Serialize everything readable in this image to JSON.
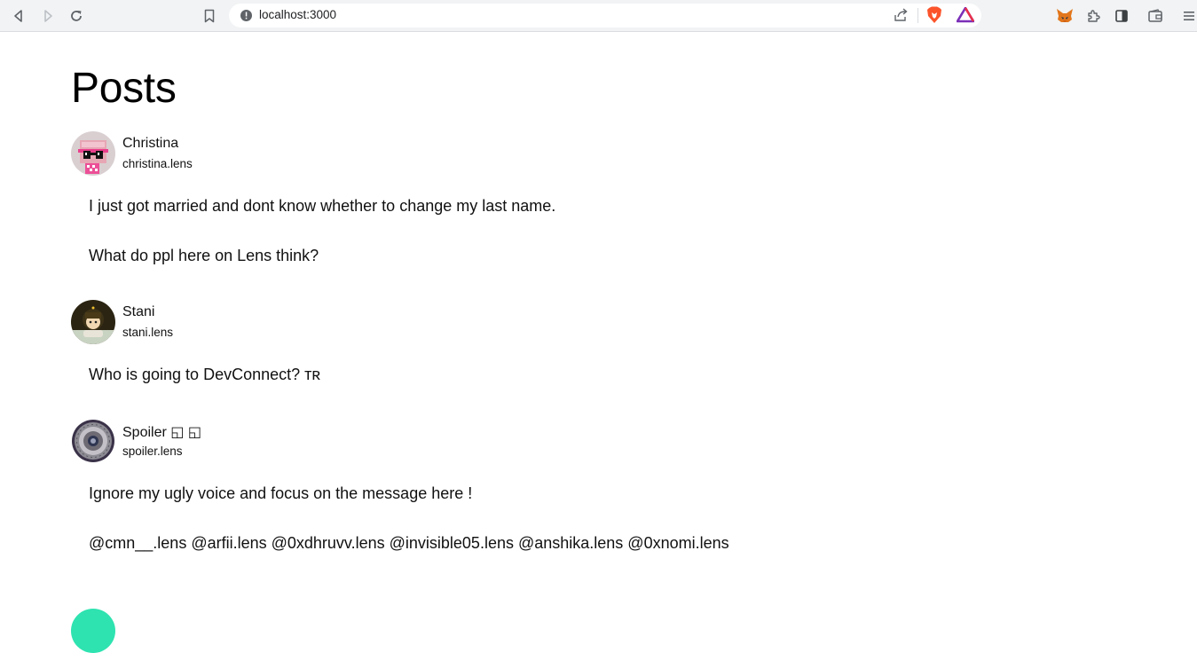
{
  "browser": {
    "url": "localhost:3000",
    "icons": [
      "back-icon",
      "forward-icon",
      "reload-icon",
      "bookmark-icon",
      "site-info-icon",
      "share-icon",
      "brave-shields-icon",
      "brave-rewards-icon",
      "metamask-icon",
      "extensions-icon",
      "sidebar-icon",
      "wallet-icon",
      "menu-icon"
    ]
  },
  "page": {
    "title": "Posts"
  },
  "posts": [
    {
      "name": "Christina",
      "handle": "christina.lens",
      "paragraphs": [
        "I just got married and dont know whether to change my last name.",
        "What do ppl here on Lens think?"
      ]
    },
    {
      "name": "Stani",
      "handle": "stani.lens",
      "paragraphs": [
        "Who is going to DevConnect? ᴛʀ"
      ]
    },
    {
      "name": "Spoiler ◱ ◱",
      "handle": "spoiler.lens",
      "paragraphs": [
        "Ignore my ugly voice and focus on the message here !",
        "@cmn__.lens @arfii.lens @0xdhruvv.lens @invisible05.lens @anshika.lens @0xnomi.lens"
      ]
    }
  ],
  "colors": {
    "toolbar_bg": "#f1f3f4",
    "next_avatar": "#2ee3b0"
  }
}
